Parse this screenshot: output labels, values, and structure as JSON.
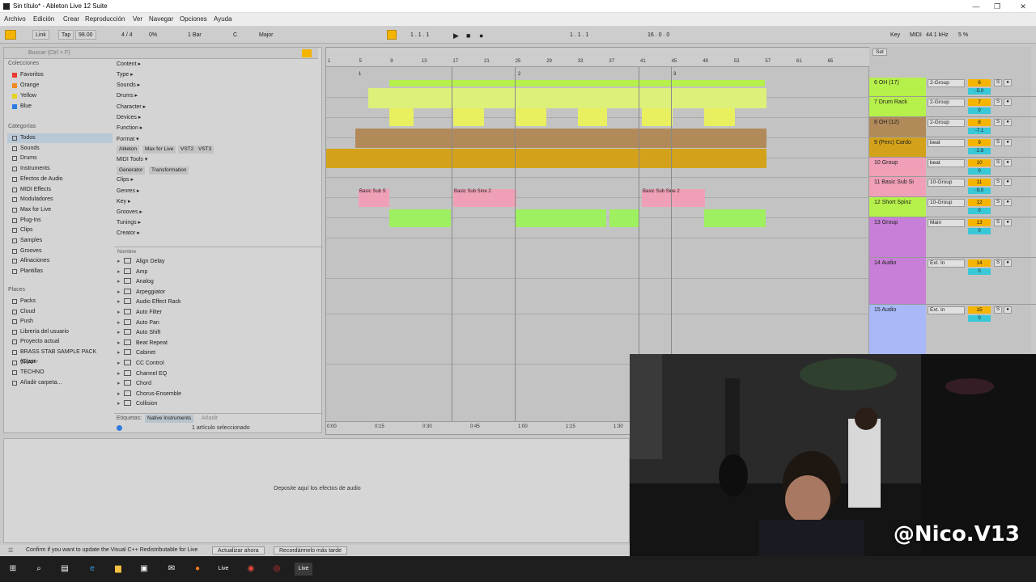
{
  "window": {
    "title": "Sin título* - Ableton Live 12 Suite",
    "minimize": "—",
    "maximize": "❐",
    "close": "✕"
  },
  "menu": [
    "Archivo",
    "Edición",
    "Crear",
    "Reproducción",
    "Ver",
    "Navegar",
    "Opciones",
    "Ayuda"
  ],
  "control_bar": {
    "link": "Link",
    "tap": "Tap",
    "tempo": "98.00",
    "signature": "4 / 4",
    "cpu": "0%",
    "quantize": "1 Bar",
    "key": "C",
    "scale": "Major",
    "position": "1 . 1 . 1",
    "loop_start": "1 . 1 . 1",
    "loop_length": "16 . 0 . 0",
    "key_map": "Key",
    "midi_map": "MIDI",
    "sample_rate": "44.1 kHz",
    "cpu_load": "5 %"
  },
  "browser": {
    "search_placeholder": "Buscar (Ctrl + F)",
    "collections_header": "Colecciones",
    "collections": [
      {
        "label": "Favoritos",
        "color": "#e83a2f"
      },
      {
        "label": "Orange",
        "color": "#f08a1e"
      },
      {
        "label": "Yellow",
        "color": "#e8d21d"
      },
      {
        "label": "Blue",
        "color": "#2e7be0"
      }
    ],
    "categories_header": "Categorías",
    "categories": [
      "Todos",
      "Sounds",
      "Drums",
      "Instruments",
      "Efectos de Audio",
      "MIDI Effects",
      "Moduladores",
      "Max for Live",
      "Plug-Ins",
      "Clips",
      "Samples",
      "Grooves",
      "Afinaciones",
      "Plantillas"
    ],
    "places_header": "Places",
    "places": [
      "Packs",
      "Cloud",
      "Push",
      "Librería del usuario",
      "Proyecto actual",
      "BRASS STAB SAMPLE PACK (Class-",
      "TRAP",
      "TECHNO",
      "Añadir carpeta..."
    ],
    "filters": [
      "Content ▸",
      "Type ▸",
      "Sounds ▸",
      "Drums ▸",
      "Character ▸",
      "Devices ▸",
      "Function ▸",
      "Format ▾",
      "MIDI Tools ▾",
      "Clips ▸",
      "Genres ▸",
      "Key ▸",
      "Grooves ▸",
      "Tunings ▸",
      "Creator ▸"
    ],
    "format_tags": [
      "Ableton",
      "Max for Live",
      "VST2",
      "VST3"
    ],
    "midi_tool_tags": [
      "Generator",
      "Transformation"
    ],
    "name_header": "Nombre",
    "files": [
      "Align Delay",
      "Amp",
      "Analog",
      "Arpeggiator",
      "Audio Effect Rack",
      "Auto Filter",
      "Auto Pan",
      "Auto Shift",
      "Beat Repeat",
      "Cabinet",
      "CC Control",
      "Channel EQ",
      "Chord",
      "Chorus-Ensemble",
      "Collision"
    ],
    "footer_label": "Etiquetas:",
    "footer_tag": "Native Instruments",
    "footer_add": "Añadir",
    "status": "1 artículo seleccionado"
  },
  "arrangement": {
    "bar_numbers": [
      "1",
      "5",
      "9",
      "13",
      "17",
      "21",
      "25",
      "29",
      "33",
      "37",
      "41",
      "45",
      "49",
      "53",
      "57",
      "61",
      "65"
    ],
    "time_marks": [
      "0:00",
      "0:15",
      "0:30",
      "0:45",
      "1:00",
      "1:15",
      "1:30"
    ],
    "clip_labels": [
      "Basic Sub S",
      "Basic Sub Sine 2",
      "Basic Sub Sine 2"
    ],
    "locators": [
      "1",
      "2",
      "3"
    ],
    "drop_text": "Deposite aquí los efectos de audio"
  },
  "mixer": {
    "set_label": "Set",
    "tracks": [
      {
        "name": "6 OH (17)",
        "io": "2-Group",
        "num": "6",
        "vol": "-5.0",
        "color": "#b6f04a"
      },
      {
        "name": "7 Drum Rack",
        "io": "2-Group",
        "num": "7",
        "vol": "0",
        "color": "#b6f04a"
      },
      {
        "name": "8 OH (12)",
        "io": "2-Group",
        "num": "8",
        "vol": "-7.1",
        "color": "#b28a5a"
      },
      {
        "name": "9 (Perc) Cardo",
        "io": "beat",
        "num": "9",
        "vol": "-2.8",
        "color": "#d4a21a"
      },
      {
        "name": "10 Group",
        "io": "beat",
        "num": "10",
        "vol": "0",
        "color": "#f0a0b6"
      },
      {
        "name": "11 Basic Sub Si",
        "io": "10-Group",
        "num": "11",
        "vol": "-5.0",
        "color": "#f0a0b6"
      },
      {
        "name": "12 Short Spinz",
        "io": "10-Group",
        "num": "12",
        "vol": "0",
        "color": "#b6f04a"
      },
      {
        "name": "13 Group",
        "io": "Main",
        "num": "13",
        "vol": "0",
        "color": "#c87fd8"
      },
      {
        "name": "14 Audio",
        "io": "Ext. In",
        "num": "14",
        "vol": "0",
        "color": "#c87fd8"
      },
      {
        "name": "15 Audio",
        "io": "Ext. In",
        "num": "15",
        "vol": "0",
        "color": "#a8b8f8"
      }
    ]
  },
  "notice": {
    "text": "Confirm if you want to update the Visual C++ Redistributable for Live",
    "update_now": "Actualizar ahora",
    "remind_later": "Recordármelo más tarde"
  },
  "webcam": {
    "watermark": "@Nico.V13"
  },
  "taskbar": {
    "live_label": "Live"
  }
}
